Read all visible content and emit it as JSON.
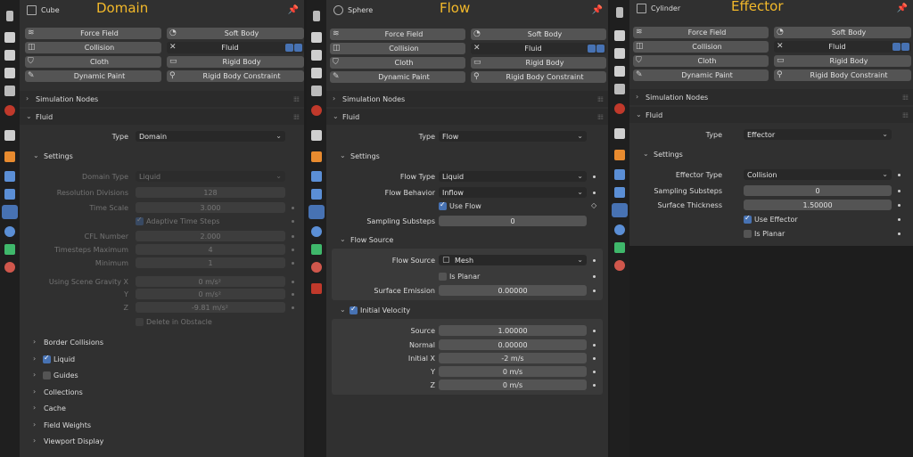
{
  "physics_buttons": {
    "force_field": "Force Field",
    "soft_body": "Soft Body",
    "collision": "Collision",
    "fluid": "Fluid",
    "cloth": "Cloth",
    "rigid_body": "Rigid Body",
    "dynamic_paint": "Dynamic Paint",
    "rigid_body_constraint": "Rigid Body Constraint"
  },
  "sections": {
    "simulation_nodes": "Simulation Nodes",
    "fluid": "Fluid",
    "type_label": "Type",
    "settings": "Settings"
  },
  "panels": [
    {
      "object_name": "Cube",
      "title": "Domain",
      "type_value": "Domain",
      "domain_type_label": "Domain Type",
      "domain_type_value": "Liquid",
      "resolution_label": "Resolution Divisions",
      "resolution_value": "128",
      "time_scale_label": "Time Scale",
      "time_scale_value": "3.000",
      "adaptive_label": "Adaptive Time Steps",
      "cfl_label": "CFL Number",
      "cfl_value": "2.000",
      "ts_max_label": "Timesteps Maximum",
      "ts_max_value": "4",
      "minimum_label": "Minimum",
      "minimum_value": "1",
      "gravity_x_label": "Using Scene Gravity X",
      "gravity_x_value": "0 m/s²",
      "gravity_y_label": "Y",
      "gravity_y_value": "0 m/s²",
      "gravity_z_label": "Z",
      "gravity_z_value": "-9.81 m/s²",
      "delete_obstacle_label": "Delete in Obstacle",
      "border_collisions": "Border Collisions",
      "liquid": "Liquid",
      "guides": "Guides",
      "collections": "Collections",
      "cache": "Cache",
      "field_weights": "Field Weights",
      "viewport_display": "Viewport Display"
    },
    {
      "object_name": "Sphere",
      "title": "Flow",
      "type_value": "Flow",
      "flow_type_label": "Flow Type",
      "flow_type_value": "Liquid",
      "flow_behavior_label": "Flow Behavior",
      "flow_behavior_value": "Inflow",
      "use_flow_label": "Use Flow",
      "sampling_label": "Sampling Substeps",
      "sampling_value": "0",
      "flow_source_header": "Flow Source",
      "flow_source_label": "Flow Source",
      "flow_source_value": "Mesh",
      "is_planar_label": "Is Planar",
      "surface_emission_label": "Surface Emission",
      "surface_emission_value": "0.00000",
      "initial_velocity_header": "Initial Velocity",
      "source_label": "Source",
      "source_value": "1.00000",
      "normal_label": "Normal",
      "normal_value": "0.00000",
      "initial_x_label": "Initial X",
      "initial_x_value": "-2 m/s",
      "y_label": "Y",
      "y_value": "0 m/s",
      "z_label": "Z",
      "z_value": "0 m/s"
    },
    {
      "object_name": "Cylinder",
      "title": "Effector",
      "type_value": "Effector",
      "effector_type_label": "Effector Type",
      "effector_type_value": "Collision",
      "sampling_label": "Sampling Substeps",
      "sampling_value": "0",
      "surface_thickness_label": "Surface Thickness",
      "surface_thickness_value": "1.50000",
      "use_effector_label": "Use Effector",
      "is_planar_label": "Is Planar"
    }
  ]
}
